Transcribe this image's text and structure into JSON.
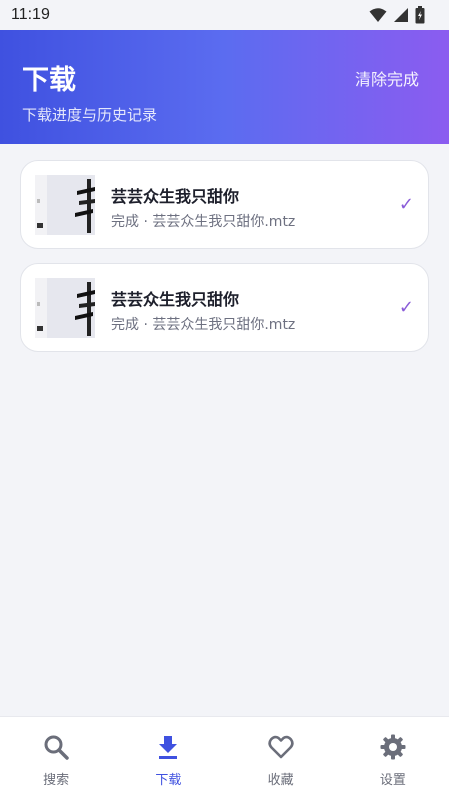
{
  "status": {
    "time": "11:19"
  },
  "header": {
    "title": "下载",
    "subtitle": "下载进度与历史记录",
    "clear_label": "清除完成"
  },
  "downloads": [
    {
      "title": "芸芸众生我只甜你",
      "subtitle": "完成 · 芸芸众生我只甜你.mtz",
      "check": "✓"
    },
    {
      "title": "芸芸众生我只甜你",
      "subtitle": "完成 · 芸芸众生我只甜你.mtz",
      "check": "✓"
    }
  ],
  "nav": {
    "items": [
      {
        "label": "搜索",
        "icon": "search-icon"
      },
      {
        "label": "下载",
        "icon": "download-icon",
        "active": true
      },
      {
        "label": "收藏",
        "icon": "heart-icon"
      },
      {
        "label": "设置",
        "icon": "gear-icon"
      }
    ]
  },
  "colors": {
    "accent": "#3f51e0",
    "gradient_end": "#8b5cf0",
    "check": "#8a5cd8"
  }
}
